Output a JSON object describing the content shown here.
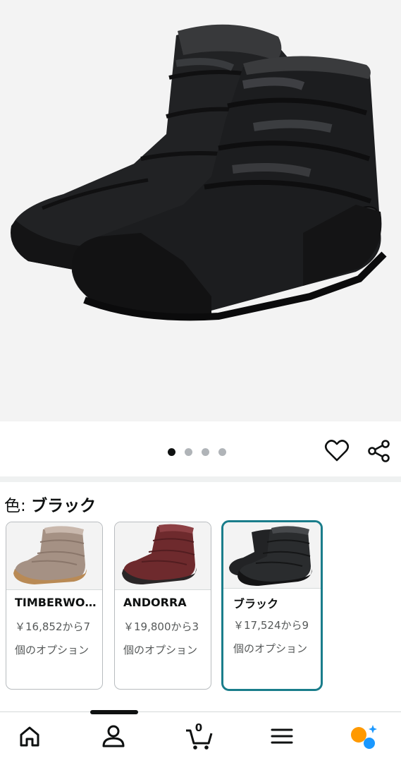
{
  "product_image": {
    "alt": "KEEN black quilted winter boots",
    "main_color": "#1c1d1f",
    "background": "#f3f3f3"
  },
  "carousel": {
    "count": 4,
    "active_index": 0
  },
  "actions": {
    "wishlist_icon": "heart-icon",
    "share_icon": "share-icon"
  },
  "color_selector": {
    "label_key": "色: ",
    "label_value": "ブラック",
    "options": [
      {
        "name": "TIMBERWOLF/GUM",
        "price_text": "￥16,852から7個のオプション",
        "boot_color": "#a59184",
        "sole_color": "#b98a55",
        "selected": false
      },
      {
        "name": "ANDORRA",
        "price_text": "￥19,800から3個のオプション",
        "boot_color": "#6e2a2d",
        "sole_color": "#2a2627",
        "selected": false
      },
      {
        "name": "ブラック",
        "price_text": "￥17,524から9個のオプション",
        "boot_color": "#2a2c2e",
        "sole_color": "#141415",
        "selected": true
      }
    ],
    "selected_border_color": "#1a7d8b"
  },
  "bottom_nav": {
    "items": [
      "home-icon",
      "account-icon",
      "cart-icon",
      "menu-icon",
      "rufus-icon"
    ],
    "cart_count": "0",
    "rufus_colors": [
      "#ff9900",
      "#1a98ff"
    ]
  }
}
